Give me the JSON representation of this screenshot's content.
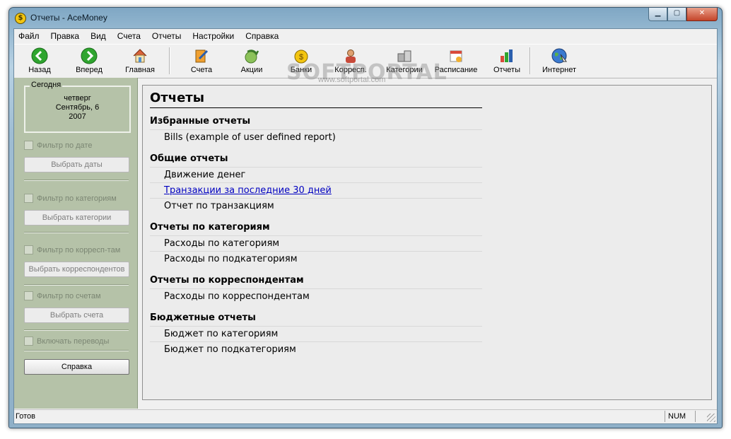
{
  "window": {
    "title": "Отчеты - AceMoney",
    "app_icon_glyph": "$"
  },
  "menu": [
    "Файл",
    "Правка",
    "Вид",
    "Счета",
    "Отчеты",
    "Настройки",
    "Справка"
  ],
  "toolbar": {
    "back": "Назад",
    "forward": "Вперед",
    "home": "Главная",
    "accounts": "Счета",
    "stocks": "Акции",
    "banks": "Банки",
    "payees": "Корресп.",
    "categories": "Категории",
    "schedule": "Расписание",
    "reports": "Отчеты",
    "internet": "Интернет"
  },
  "watermark": {
    "main": "SOFTPORTAL",
    "sub": "www.softportal.com"
  },
  "sidebar": {
    "today_label": "Сегодня",
    "weekday": "четверг",
    "date": "Сентябрь, 6",
    "year": "2007",
    "date_filter": "Фильтр по дате",
    "date_button": "Выбрать даты",
    "category_filter": "Фильтр по категориям",
    "category_button": "Выбрать категории",
    "payee_filter": "Фильтр по корресп-там",
    "payee_button": "Выбрать корреспондентов",
    "account_filter": "Фильтр по счетам",
    "account_button": "Выбрать счета",
    "transfers": "Включать переводы",
    "help_button": "Справка"
  },
  "content": {
    "title": "Отчеты",
    "sections": [
      {
        "title": "Избранные отчеты",
        "items": [
          "Bills (example of user defined report)"
        ]
      },
      {
        "title": "Общие отчеты",
        "items": [
          "Движение денег",
          "Транзакции за последние 30 дней",
          "Отчет по транзакциям"
        ]
      },
      {
        "title": "Отчеты по категориям",
        "items": [
          "Расходы по категориям",
          "Расходы по подкатегориям"
        ]
      },
      {
        "title": "Отчеты по корреспондентам",
        "items": [
          "Расходы по корреспондентам"
        ]
      },
      {
        "title": "Бюджетные отчеты",
        "items": [
          "Бюджет по категориям",
          "Бюджет по подкатегориям"
        ]
      }
    ]
  },
  "status": {
    "text": "Готов",
    "num": "NUM"
  },
  "colors": {
    "sidebar_bg": "#b5c2a8",
    "link": "#0000c0",
    "accent_green": "#2fa52f"
  }
}
